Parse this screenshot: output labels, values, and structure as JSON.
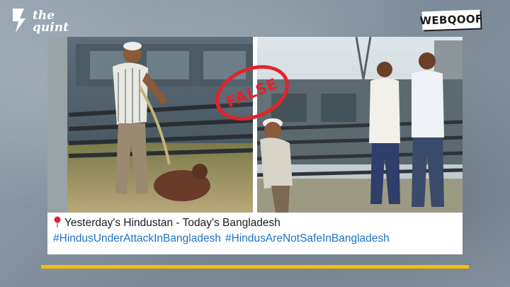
{
  "brand": {
    "logo_top": "the",
    "logo_bottom": "quint",
    "badge": "WEBQOOF"
  },
  "stamp": {
    "label": "FALSE"
  },
  "post": {
    "caption": "Yesterday's Hindustan - Today's Bangladesh",
    "hashtags": [
      "#HindusUnderAttackInBangladesh",
      "#HindusAreNotSafeInBangladesh"
    ]
  },
  "colors": {
    "accent_yellow": "#f2c200",
    "stamp_red": "#e0242a",
    "hashtag_blue": "#1d73c9"
  }
}
